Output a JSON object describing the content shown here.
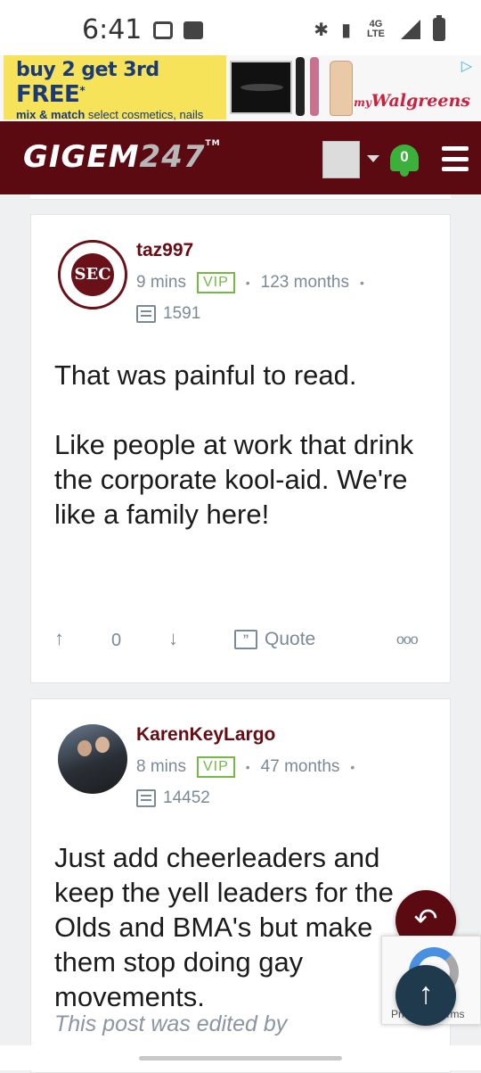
{
  "status_bar": {
    "time": "6:41",
    "network": "4G LTE"
  },
  "ad": {
    "headline_pre": "buy 2 get 3rd ",
    "headline_free": "FREE",
    "headline_star": "*",
    "sub_bold": "mix & match",
    "sub_rest": " select cosmetics, nails and accessories",
    "brand_prefix": "my",
    "brand": "Walgreens"
  },
  "header": {
    "logo_text": "GIGEM",
    "logo_num": "247",
    "logo_tm": "TM",
    "notification_count": "0"
  },
  "posts": [
    {
      "username": "taz997",
      "time": "9 mins",
      "badge": "VIP",
      "tenure": "123 months",
      "post_count": "1591",
      "body": [
        "That was painful to read.",
        "Like people at work that drink the corporate kool-aid. We're like a family here!"
      ],
      "votes": "0",
      "quote_label": "Quote",
      "more_label": "ooo"
    },
    {
      "username": "KarenKeyLargo",
      "time": "8 mins",
      "badge": "VIP",
      "tenure": "47 months",
      "post_count": "14452",
      "body": [
        "Just add cheerleaders and keep the yell leaders for the Olds and BMA's but make them stop doing gay movements."
      ],
      "edited_note": "This post was edited by"
    }
  ],
  "recaptcha": {
    "text": "Privacy - Terms"
  },
  "colors": {
    "brand_maroon": "#5c0a12",
    "vip_green": "#74b944",
    "bell_green": "#3bb13c",
    "scroll_top_fab": "#1e3a4c"
  }
}
